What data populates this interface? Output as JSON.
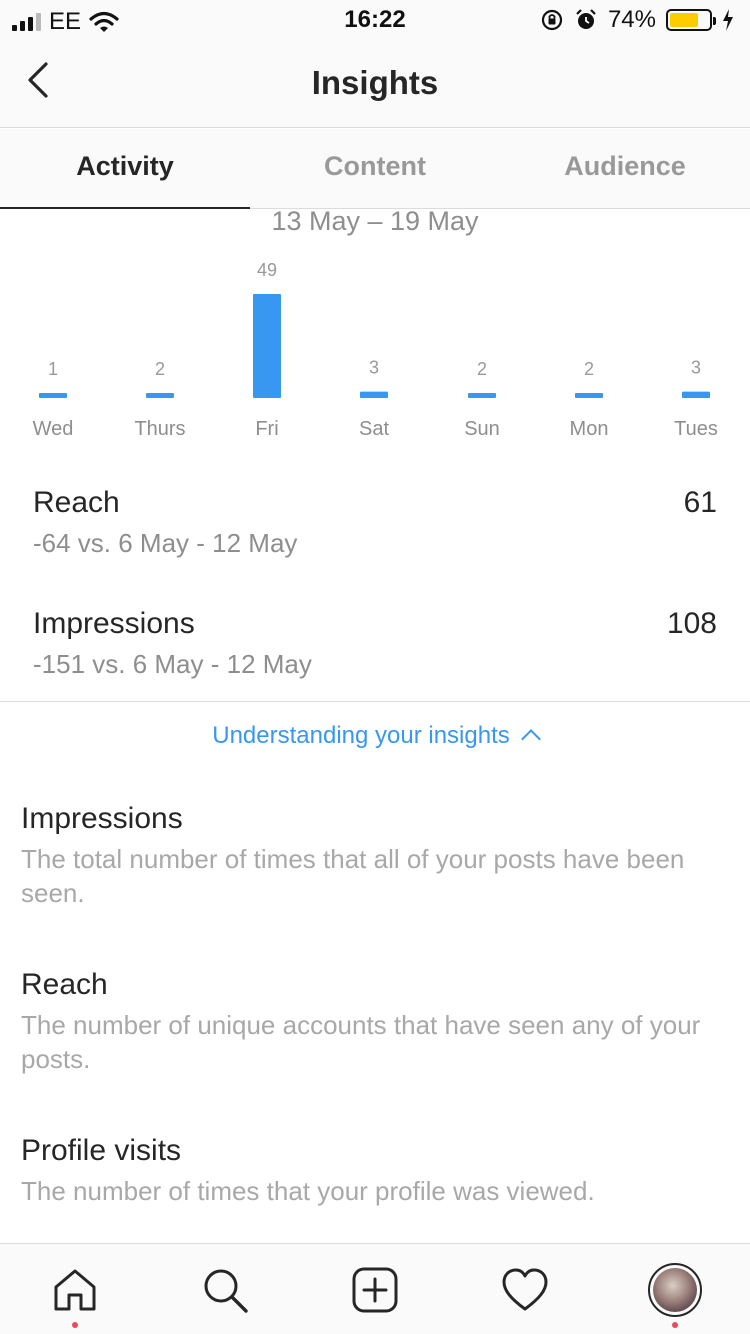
{
  "status_bar": {
    "carrier": "EE",
    "time": "16:22",
    "battery_pct": "74%",
    "battery_level": 0.74,
    "battery_color": "#ffcc00"
  },
  "header": {
    "title": "Insights"
  },
  "tabs": [
    {
      "label": "Activity",
      "active": true
    },
    {
      "label": "Content",
      "active": false
    },
    {
      "label": "Audience",
      "active": false
    }
  ],
  "date_range": "13 May – 19 May",
  "chart_data": {
    "type": "bar",
    "categories": [
      "Wed",
      "Thurs",
      "Fri",
      "Sat",
      "Sun",
      "Mon",
      "Tues"
    ],
    "values": [
      1,
      2,
      49,
      3,
      2,
      2,
      3
    ],
    "bar_color": "#3897f0"
  },
  "stats": [
    {
      "label": "Reach",
      "value": "61",
      "compare": "-64 vs. 6 May - 12 May"
    },
    {
      "label": "Impressions",
      "value": "108",
      "compare": "-151 vs. 6 May - 12 May"
    }
  ],
  "understanding": {
    "label": "Understanding your insights"
  },
  "definitions": [
    {
      "title": "Impressions",
      "desc": "The total number of times that all of your posts have been seen."
    },
    {
      "title": "Reach",
      "desc": "The number of unique accounts that have seen any of your posts."
    },
    {
      "title": "Profile visits",
      "desc": "The number of times that your profile was viewed."
    }
  ],
  "tabbar": {
    "icons": [
      "home-icon",
      "search-icon",
      "new-post-icon",
      "activity-heart-icon",
      "profile-avatar"
    ],
    "notification_color": "#ed4956"
  }
}
